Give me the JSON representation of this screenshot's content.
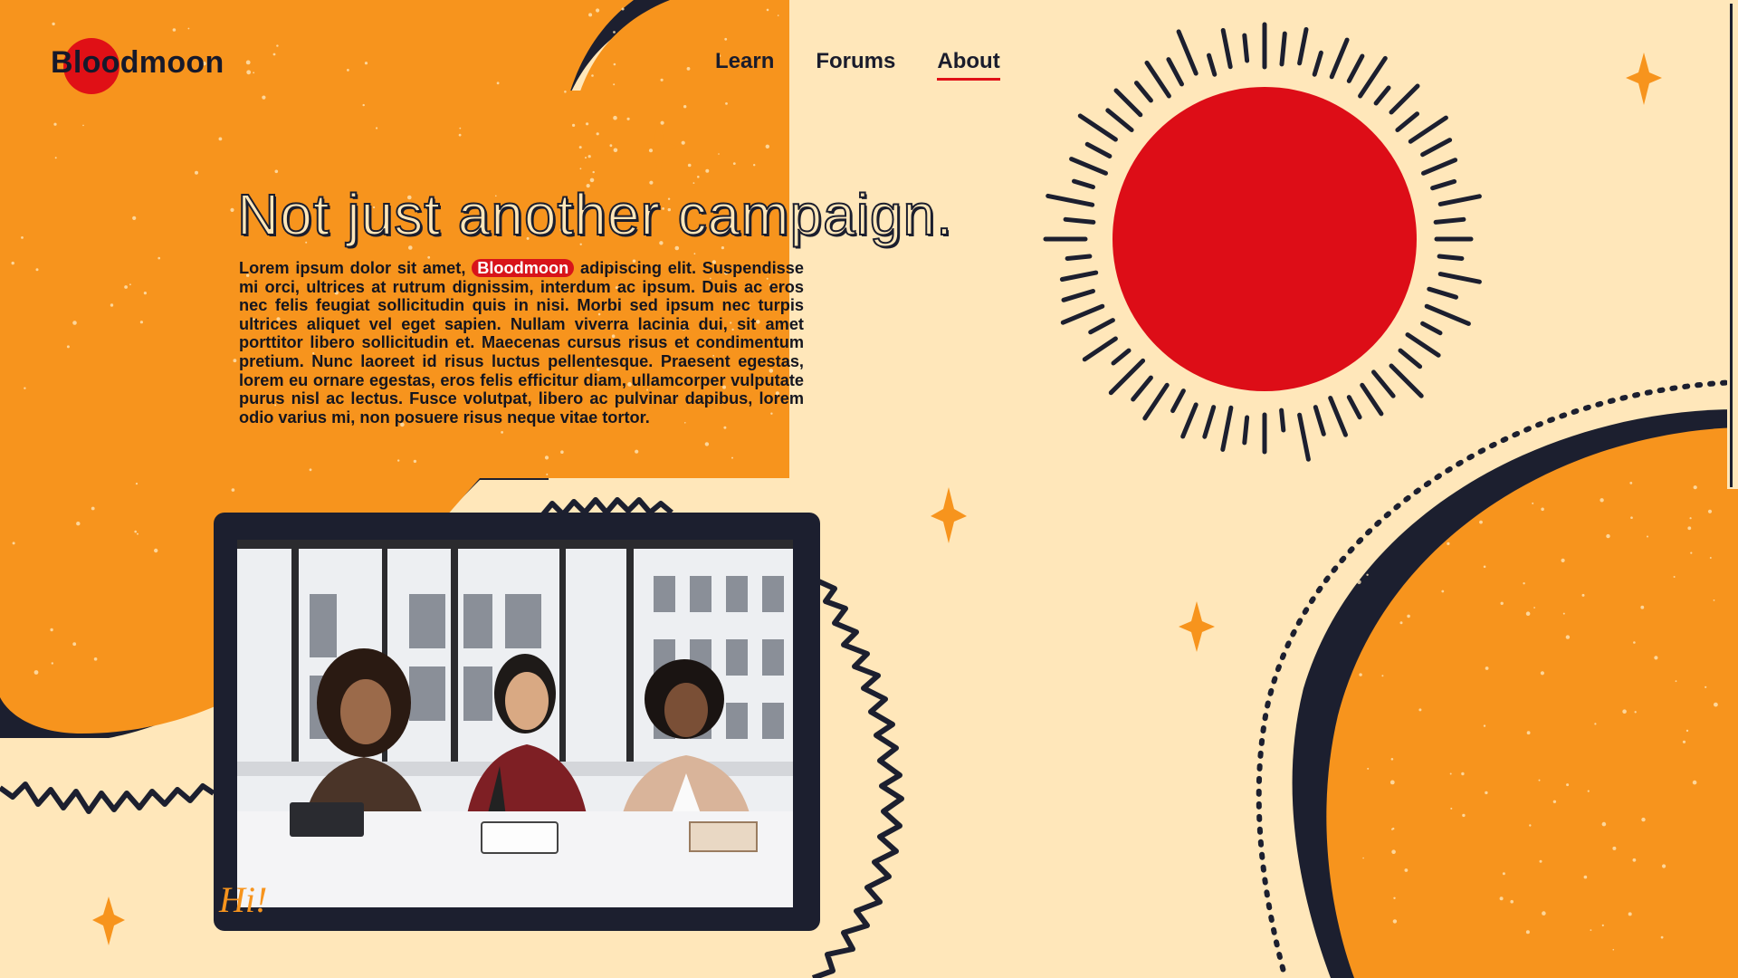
{
  "brand": {
    "name": "Bloodmoon"
  },
  "nav": {
    "items": [
      {
        "label": "Learn",
        "active": false
      },
      {
        "label": "Forums",
        "active": false
      },
      {
        "label": "About",
        "active": true
      }
    ]
  },
  "hero": {
    "title": "Not just another campaign.",
    "body_before": "Lorem ipsum dolor sit amet,",
    "body_brand": "Bloodmoon",
    "body_after": "adipiscing elit. Suspendisse mi orci, ultrices at rutrum dignissim, interdum ac ipsum. Duis ac eros nec felis feugiat sollicitudin quis in nisi. Morbi sed ipsum nec turpis ultrices aliquet vel eget sapien. Nullam viverra lacinia dui, sit amet porttitor libero sollicitudin et. Maecenas cursus risus et condimentum pretium. Nunc laoreet id risus luctus pellentesque. Praesent egestas, lorem eu ornare egestas, eros felis efficitur diam, ullamcorper vulputate purus nisl ac lectus. Fusce volutpat, libero ac pulvinar dapibus, lorem odio varius mi, non posuere risus neque vitae tortor."
  },
  "photo": {
    "caption": "Hi!"
  },
  "colors": {
    "background": "#FFE7BA",
    "orange": "#F7941D",
    "navy": "#1C1F2F",
    "red": "#DD0D17"
  },
  "icons": [
    "sun-illustration",
    "sparkle-icon",
    "zigzag-line"
  ]
}
